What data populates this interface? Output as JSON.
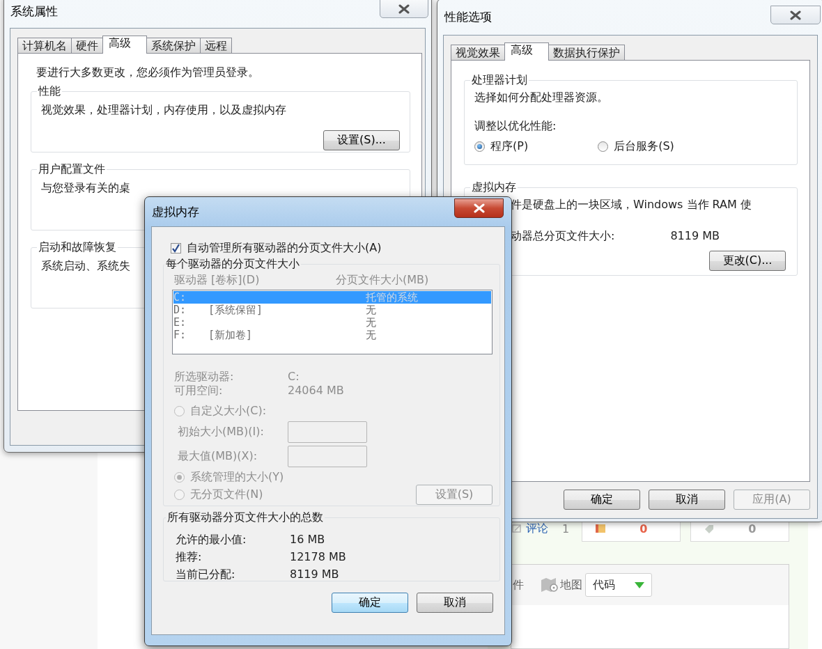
{
  "web_page": {
    "comment_link": "评论",
    "comment_count": "1",
    "stats": [
      {
        "value": "0",
        "color": "#e8634a"
      },
      {
        "value": "0",
        "color": "#9a9a9a"
      }
    ],
    "toolbar": [
      "件",
      "地图"
    ],
    "dropdown": {
      "value": "代码"
    }
  },
  "system_properties": {
    "title": "系统属性",
    "tabs": [
      {
        "label": "计算机名",
        "selected": false
      },
      {
        "label": "硬件",
        "selected": false
      },
      {
        "label": "高级",
        "selected": true
      },
      {
        "label": "系统保护",
        "selected": false
      },
      {
        "label": "远程",
        "selected": false
      }
    ],
    "notice": "要进行大多数更改，您必须作为管理员登录。",
    "groups": [
      {
        "title": "性能",
        "text": "视觉效果，处理器计划，内存使用，以及虚拟内存",
        "button": "设置(S)..."
      },
      {
        "title": "用户配置文件",
        "text": "与您登录有关的桌"
      },
      {
        "title": "启动和故障恢复",
        "text": "系统启动、系统失"
      }
    ]
  },
  "performance_options": {
    "title": "性能选项",
    "tabs": [
      {
        "label": "视觉效果",
        "selected": false
      },
      {
        "label": "高级",
        "selected": true
      },
      {
        "label": "数据执行保护",
        "selected": false
      }
    ],
    "processor_group": {
      "title": "处理器计划",
      "text": "选择如何分配处理器资源。",
      "prompt": "调整以优化性能:",
      "options": [
        {
          "label": "程序(P)",
          "selected": true
        },
        {
          "label": "后台服务(S)",
          "selected": false
        }
      ]
    },
    "virtual_memory_group": {
      "title": "虚拟内存",
      "text": "件是硬盘上的一块区域，Windows 当作 RAM 使",
      "total_label": "动器总分页文件大小:",
      "total_value": "8119 MB",
      "button": "更改(C)..."
    },
    "buttons": [
      {
        "label": "确定",
        "disabled": false
      },
      {
        "label": "取消",
        "disabled": false
      },
      {
        "label": "应用(A)",
        "disabled": true
      }
    ]
  },
  "virtual_memory": {
    "title": "虚拟内存",
    "auto_manage": {
      "label": "自动管理所有驱动器的分页文件大小(A)",
      "checked": true
    },
    "per_drive": {
      "title": "每个驱动器的分页文件大小",
      "disabled": true,
      "columns": [
        "驱动器 [卷标](D)",
        "分页文件大小(MB)"
      ],
      "drives": [
        {
          "drive": "C:",
          "size": "托管的系统",
          "selected": true
        },
        {
          "drive": "D:",
          "volume": "[系统保留]",
          "size": "无",
          "selected": false
        },
        {
          "drive": "E:",
          "size": "无",
          "selected": false
        },
        {
          "drive": "F:",
          "volume": "[新加卷]",
          "size": "无",
          "selected": false
        }
      ],
      "selected_drive_label": "所选驱动器:",
      "selected_drive": "C:",
      "free_space_label": "可用空间:",
      "free_space": "24064 MB",
      "options": [
        {
          "label": "自定义大小(C):",
          "selected": false
        },
        {
          "label": "系统管理的大小(Y)",
          "selected": true
        },
        {
          "label": "无分页文件(N)",
          "selected": false
        }
      ],
      "initial_size": {
        "label": "初始大小(MB)(I):"
      },
      "max_size": {
        "label": "最大值(MB)(X):"
      },
      "set_button": {
        "label": "设置(S)",
        "disabled": true
      }
    },
    "totals": {
      "title": "所有驱动器分页文件大小的总数",
      "rows": [
        {
          "label": "允许的最小值:",
          "value": "16 MB"
        },
        {
          "label": "推荐:",
          "value": "12178 MB"
        },
        {
          "label": "当前已分配:",
          "value": "8119 MB"
        }
      ]
    },
    "buttons": [
      {
        "label": "确定",
        "default": true
      },
      {
        "label": "取消",
        "default": false
      }
    ]
  }
}
